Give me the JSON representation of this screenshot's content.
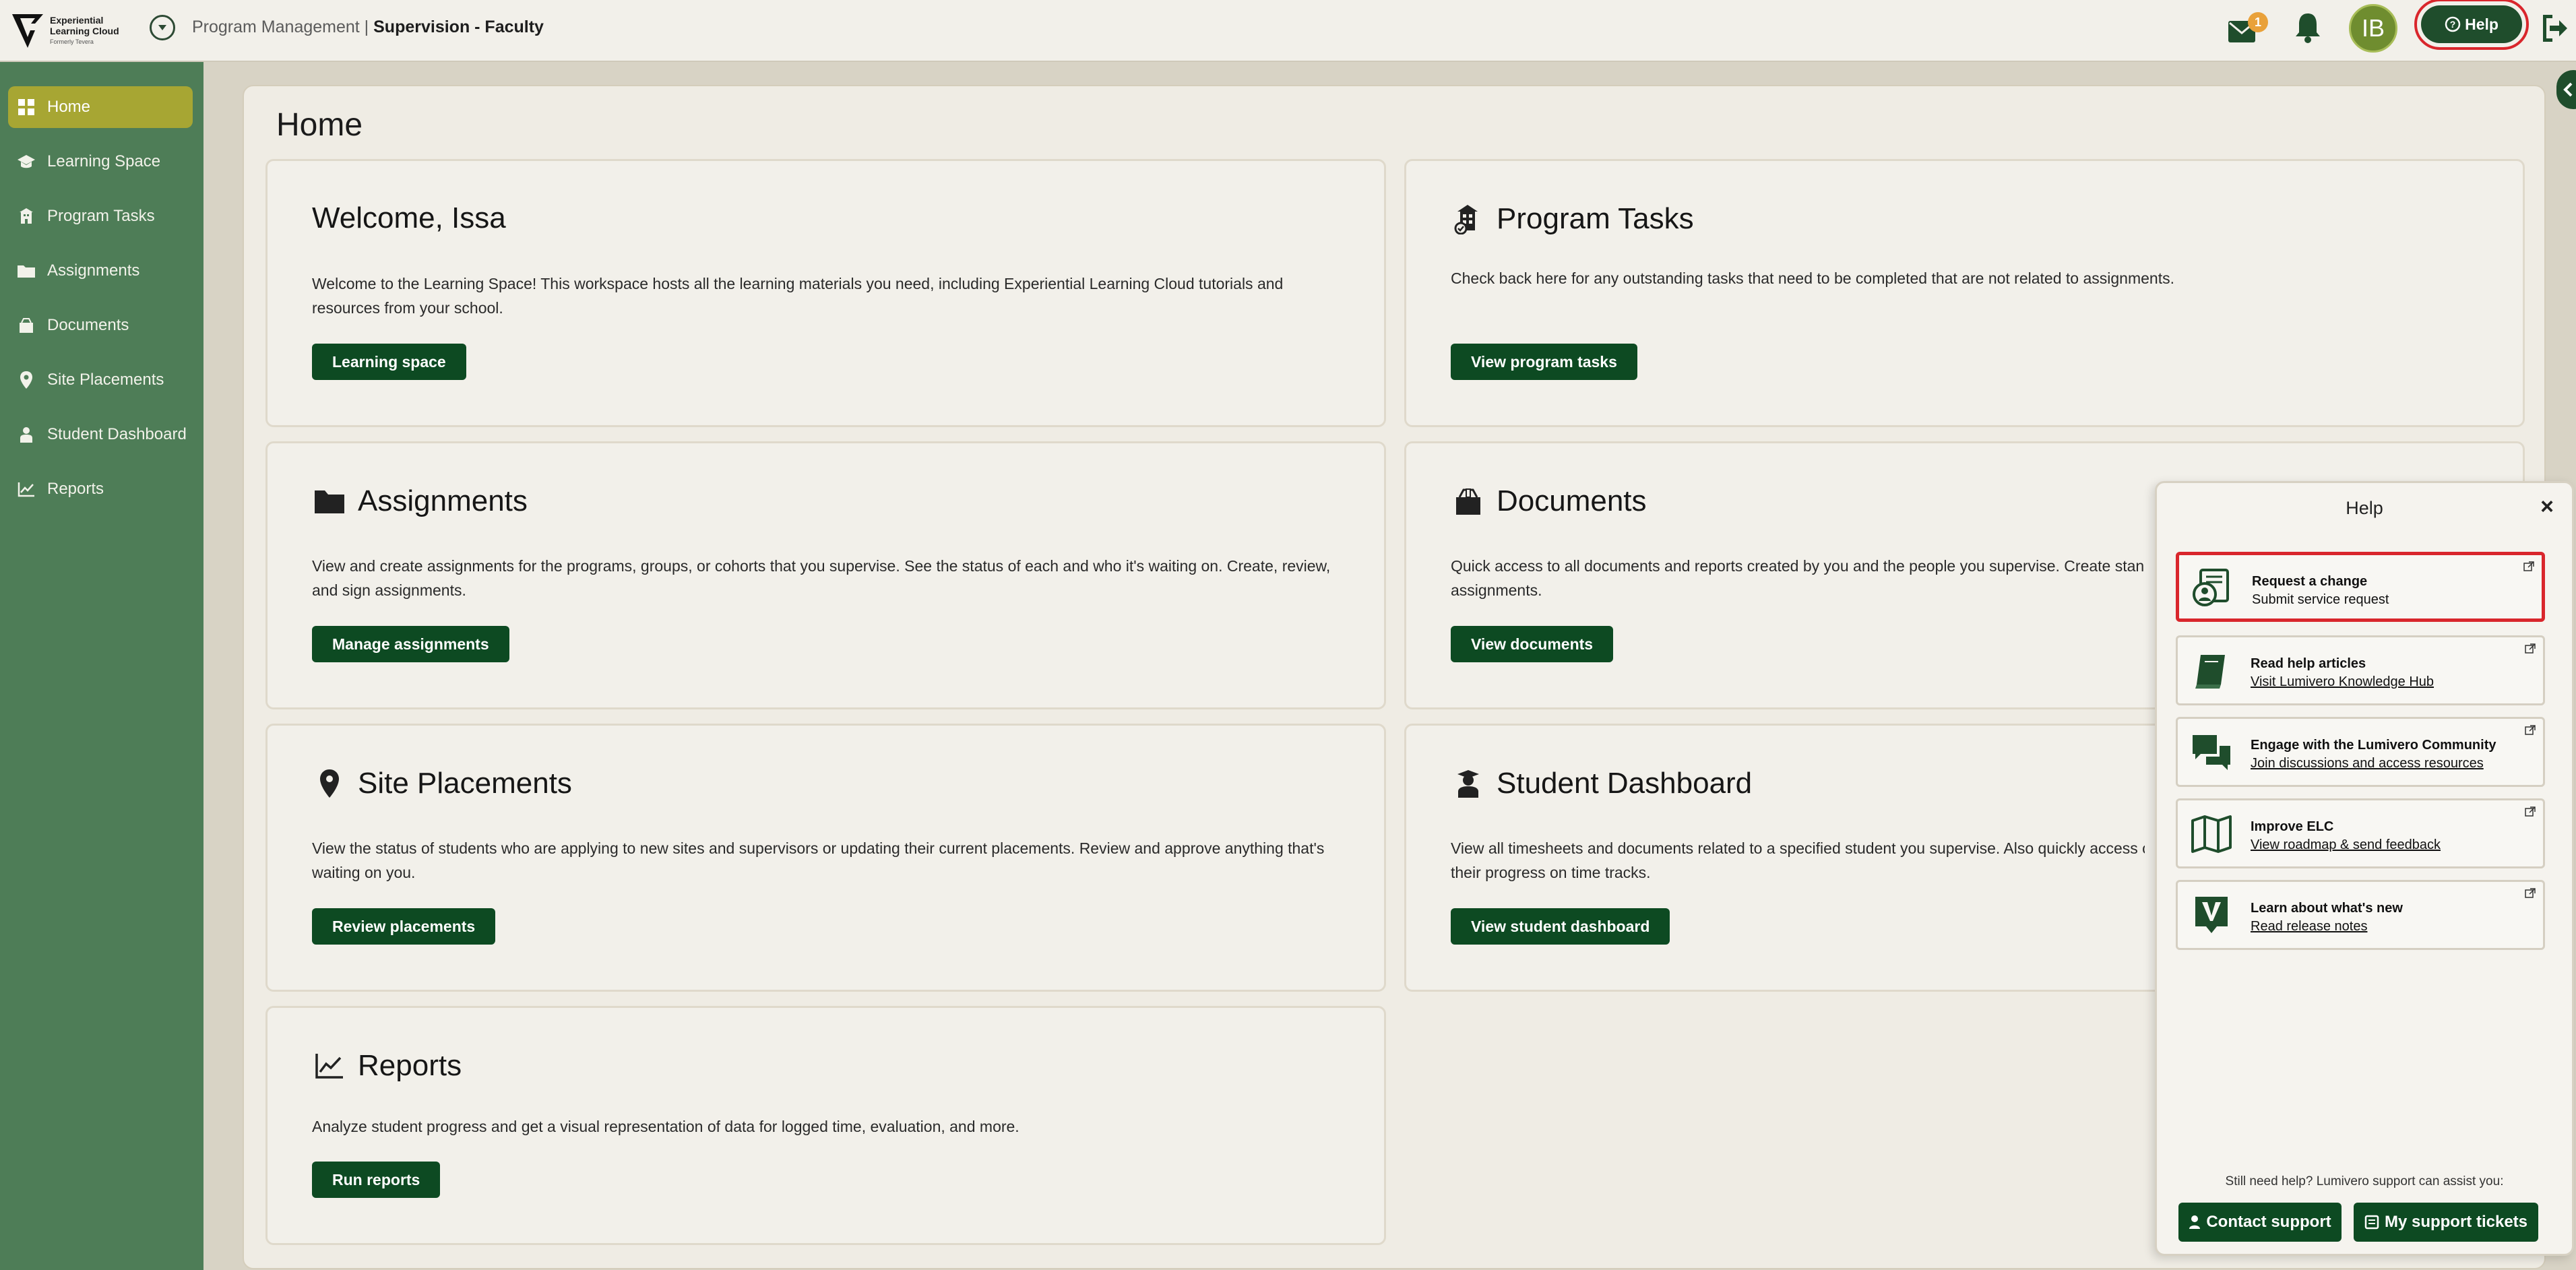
{
  "header": {
    "logo_line1": "Experiential",
    "logo_line2": "Learning Cloud",
    "logo_line3": "Formerly Tevera",
    "breadcrumb_parent": "Program Management |",
    "breadcrumb_current": "Supervision - Faculty",
    "mail_badge": "1",
    "avatar_initials": "IB",
    "help_label": "Help"
  },
  "sidebar": {
    "items": [
      {
        "label": "Home",
        "icon": "grid-icon"
      },
      {
        "label": "Learning Space",
        "icon": "graduation-cap-icon"
      },
      {
        "label": "Program Tasks",
        "icon": "building-icon"
      },
      {
        "label": "Assignments",
        "icon": "folder-icon"
      },
      {
        "label": "Documents",
        "icon": "box-icon"
      },
      {
        "label": "Site Placements",
        "icon": "map-pin-icon"
      },
      {
        "label": "Student Dashboard",
        "icon": "student-icon"
      },
      {
        "label": "Reports",
        "icon": "chart-line-icon"
      }
    ]
  },
  "main": {
    "title": "Home",
    "cards": {
      "welcome": {
        "title": "Welcome, Issa",
        "desc": "Welcome to the Learning Space! This workspace hosts all the learning materials you need, including Experiential Learning Cloud tutorials and resources from your school.",
        "button": "Learning space"
      },
      "program_tasks": {
        "title": "Program Tasks",
        "desc": "Check back here for any outstanding tasks that need to be completed that are not related to assignments.",
        "button": "View program tasks"
      },
      "assignments": {
        "title": "Assignments",
        "desc": "View and create assignments for the programs, groups, or cohorts that you supervise. See the status of each and who it's waiting on. Create, review, and sign assignments.",
        "button": "Manage assignments"
      },
      "documents": {
        "title": "Documents",
        "desc": "Quick access to all documents and reports created by you and the people you supervise. Create stand",
        "desc2": "assignments.",
        "button": "View documents"
      },
      "site_placements": {
        "title": "Site Placements",
        "desc": "View the status of students who are applying to new sites and supervisors or updating their current placements. Review and approve anything that's waiting on you.",
        "button": "Review placements"
      },
      "student_dashboard": {
        "title": "Student Dashboard",
        "desc": "View all timesheets and documents related to a specified student you supervise. Also quickly access c",
        "desc2": "their progress on time tracks.",
        "button": "View student dashboard"
      },
      "reports": {
        "title": "Reports",
        "desc": "Analyze student progress and get a visual representation of data for logged time, evaluation, and more.",
        "button": "Run reports"
      }
    }
  },
  "help_panel": {
    "title": "Help",
    "close": "×",
    "items": [
      {
        "title": "Request a change",
        "sub": "Submit service request",
        "icon": "request-change-icon"
      },
      {
        "title": "Read help articles",
        "sub": "Visit Lumivero Knowledge Hub",
        "icon": "book-icon"
      },
      {
        "title": "Engage with the Lumivero Community",
        "sub": "Join discussions and access resources",
        "icon": "chat-icon"
      },
      {
        "title": "Improve ELC",
        "sub": "View roadmap & send feedback",
        "icon": "map-icon"
      },
      {
        "title": "Learn about what's new",
        "sub": "Read release notes",
        "icon": "release-notes-icon"
      }
    ],
    "still_help": "Still need help? Lumivero support can assist you:",
    "contact_support": "Contact support",
    "my_tickets": "My support tickets"
  },
  "colors": {
    "sidebar": "#4e7d57",
    "active_nav": "#a7a633",
    "primary_button": "#0d4a22",
    "highlight": "#d9262c",
    "mail_badge": "#e9a13a"
  }
}
